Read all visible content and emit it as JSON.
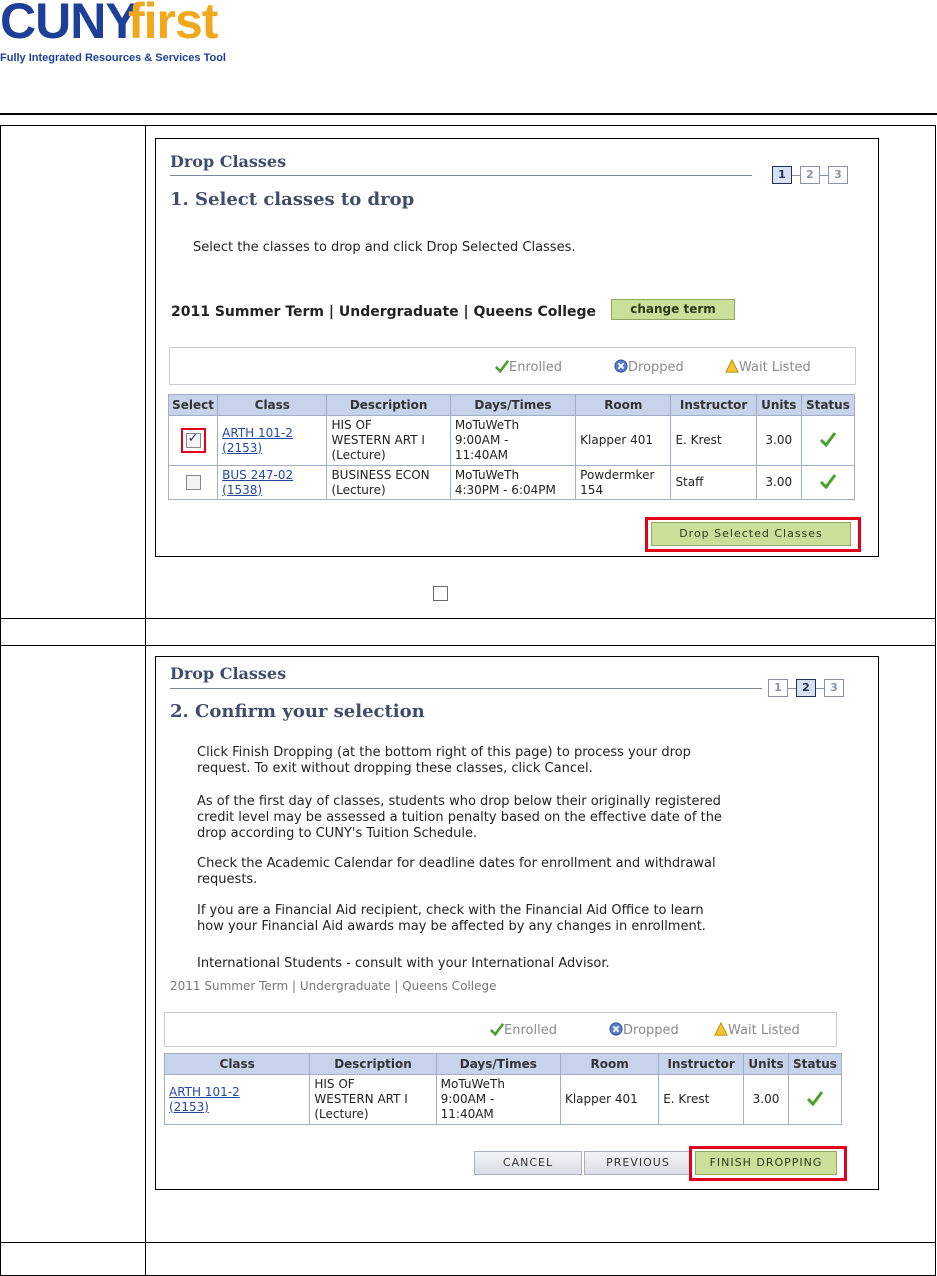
{
  "logo": {
    "brand_cuny": "CUNY",
    "brand_first": "first",
    "tagline": "Fully Integrated Resources & Services Tool"
  },
  "panel1": {
    "title": "Drop Classes",
    "subtitle": "1.  Select classes to drop",
    "steps": [
      "1",
      "2",
      "3"
    ],
    "active_step": 1,
    "instruction": "Select the classes to drop and click Drop Selected Classes.",
    "term": "2011 Summer Term | Undergraduate | Queens College",
    "change_term_label": "change term",
    "legend": {
      "enrolled": "Enrolled",
      "dropped": "Dropped",
      "waitlisted": "Wait Listed"
    },
    "columns": [
      "Select",
      "Class",
      "Description",
      "Days/Times",
      "Room",
      "Instructor",
      "Units",
      "Status"
    ],
    "rows": [
      {
        "checked": true,
        "class_line1": "ARTH 101-2",
        "class_line2": "(2153)",
        "desc_line1": "HIS OF",
        "desc_line2": "WESTERN ART I",
        "desc_line3": "(Lecture)",
        "days_line1": "MoTuWeTh",
        "days_line2": "9:00AM -",
        "days_line3": "11:40AM",
        "room": "Klapper 401",
        "instructor": "E. Krest",
        "units": "3.00"
      },
      {
        "checked": false,
        "class_line1": "BUS 247-02",
        "class_line2": "(1538)",
        "desc_line1": "BUSINESS ECON",
        "desc_line2": "(Lecture)",
        "days_line1": "MoTuWeTh",
        "days_line2": "4:30PM - 6:04PM",
        "room_line1": "Powdermker",
        "room_line2": "154",
        "instructor": "Staff",
        "units": "3.00"
      }
    ],
    "drop_button": "Drop Selected Classes"
  },
  "panel2": {
    "title": "Drop Classes",
    "subtitle": "2.  Confirm your selection",
    "steps": [
      "1",
      "2",
      "3"
    ],
    "active_step": 2,
    "para1_line1": "Click Finish Dropping (at the bottom right of this page) to process your drop",
    "para1_line2": "request. To exit without dropping these classes, click Cancel.",
    "para2_line1": "As of the first day of classes, students who drop below their originally registered",
    "para2_line2": "credit level may be assessed a tuition penalty based on the effective date of the",
    "para2_line3": "drop according to CUNY's Tuition Schedule.",
    "para3_line1": "Check the Academic Calendar for deadline dates for enrollment and withdrawal",
    "para3_line2": "requests.",
    "para4_line1": "If you are a Financial Aid recipient, check with the Financial Aid Office to learn",
    "para4_line2": "how your Financial Aid awards may be affected by any changes in enrollment.",
    "para5": "International Students - consult with your International Advisor.",
    "term": "2011 Summer Term | Undergraduate | Queens College",
    "legend": {
      "enrolled": "Enrolled",
      "dropped": "Dropped",
      "waitlisted": "Wait Listed"
    },
    "columns": [
      "Class",
      "Description",
      "Days/Times",
      "Room",
      "Instructor",
      "Units",
      "Status"
    ],
    "row": {
      "class_line1": "ARTH 101-2",
      "class_line2": "(2153)",
      "desc_line1": "HIS OF",
      "desc_line2": "WESTERN ART I",
      "desc_line3": "(Lecture)",
      "days_line1": "MoTuWeTh",
      "days_line2": "9:00AM -",
      "days_line3": "11:40AM",
      "room": "Klapper 401",
      "instructor": "E. Krest",
      "units": "3.00"
    },
    "cancel_button": "Cancel",
    "previous_button": "Previous",
    "finish_button": "Finish Dropping"
  },
  "colors": {
    "accent_red": "#e3001b",
    "button_green": "#c9df9a",
    "header_blue": "#c6d3ea",
    "brand_blue": "#1e3f98",
    "brand_gold": "#f2a81d"
  }
}
